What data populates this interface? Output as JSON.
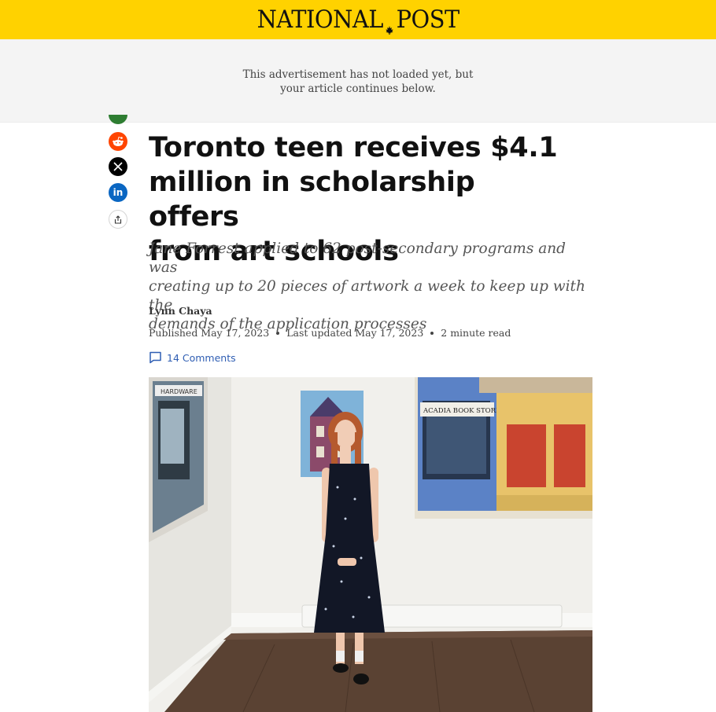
{
  "header": {
    "logo_left": "NATIONAL",
    "logo_right": "POST",
    "logo_icon": "maple-leaf-icon",
    "brand_color": "#ffd200"
  },
  "ad": {
    "line1": "This advertisement has not loaded yet, but",
    "line2": "your article continues below."
  },
  "share": {
    "icons": [
      "facebook-icon",
      "reddit-icon",
      "x-icon",
      "linkedin-icon",
      "share-icon"
    ],
    "linkedin_text": "in"
  },
  "article": {
    "headline_line1": "Toronto teen receives $4.1",
    "headline_line2": "million in scholarship offers",
    "headline_line3": "from art schools",
    "subhead_line1": "Jane Forrest applied to 62 post-secondary programs and was",
    "subhead_line2": "creating up to 20 pieces of artwork a week to keep up with the",
    "subhead_line3": "demands of the application processes",
    "author": "Lynn Chaya",
    "published": "Published May 17, 2023",
    "updated": "Last updated May 17, 2023",
    "read_time": "2 minute read",
    "comments": "14 Comments"
  },
  "photo": {
    "storefront_sign": "ACADIA BOOK STORE",
    "left_sign": "HARDWARE"
  }
}
